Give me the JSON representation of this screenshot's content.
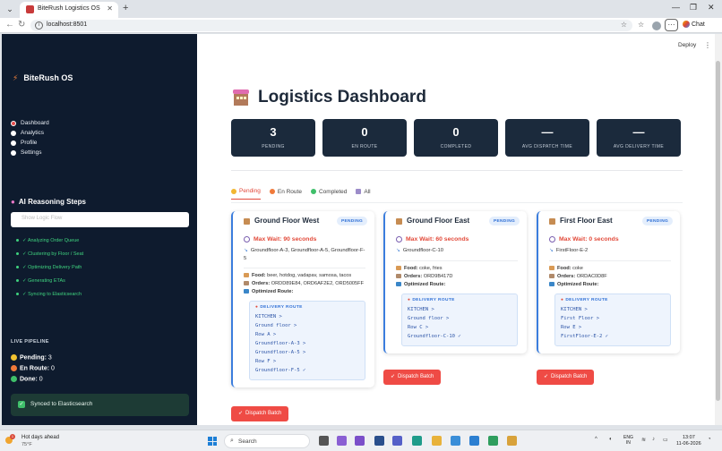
{
  "browser": {
    "tab_title": "BiteRush Logistics OS",
    "url": "localhost:8501",
    "chat_label": "Chat"
  },
  "toolbar": {
    "deploy": "Deploy"
  },
  "sidebar": {
    "brand": "BiteRush OS",
    "nav": [
      "Dashboard",
      "Analytics",
      "Profile",
      "Settings"
    ],
    "selected_nav": "Dashboard",
    "reasoning_title": "AI Reasoning Steps",
    "logic_placeholder": "Show Logic Flow",
    "steps": [
      "✓ Analyzing Order Queue",
      "✓ Clustering by Floor / Seat",
      "✓ Optimizing Delivery Path",
      "✓ Generating ETAs",
      "✓ Syncing to Elasticsearch"
    ],
    "pipeline_title": "LIVE PIPELINE",
    "pipeline": [
      {
        "label": "Pending:",
        "value": "3",
        "color": "#f2c231"
      },
      {
        "label": "En Route:",
        "value": "0",
        "color": "#f07a3a"
      },
      {
        "label": "Done:",
        "value": "0",
        "color": "#3fbf6a"
      }
    ],
    "synced": "Synced to Elasticsearch"
  },
  "main": {
    "title": "Logistics Dashboard",
    "kpis": [
      {
        "value": "3",
        "label": "PENDING"
      },
      {
        "value": "0",
        "label": "EN ROUTE"
      },
      {
        "value": "0",
        "label": "COMPLETED"
      },
      {
        "value": "—",
        "label": "AVG DISPATCH TIME"
      },
      {
        "value": "—",
        "label": "AVG DELIVERY TIME"
      }
    ],
    "tabs": [
      {
        "label": "Pending",
        "color": "#f2b631"
      },
      {
        "label": "En Route",
        "color": "#f07a3a"
      },
      {
        "label": "Completed",
        "color": "#3fbf6a"
      },
      {
        "label": "All",
        "color": "#9c8cc9"
      }
    ],
    "cards": [
      {
        "name": "Ground Floor West",
        "badge": "PENDING",
        "max_wait": "Max Wait: 90 seconds",
        "locations": "Groundfloor-A-3, Groundfloor-A-5, Groundfloor-F-5",
        "food_label": "Food:",
        "food": "beer, hotdog, vadapav, samosa, tacos",
        "orders_label": "Orders:",
        "orders": "ORDD89E84, ORD6AF2E2, ORD5005FF",
        "route_label": "Optimized Route:",
        "route_title": "DELIVERY ROUTE",
        "route": [
          "KITCHEN >",
          "Ground floor >",
          "Row A >",
          "Groundfloor-A-3 >",
          "Groundfloor-A-5 >",
          "Row F >",
          "Groundfloor-F-5 ✓"
        ],
        "dispatch": "Dispatch Batch"
      },
      {
        "name": "Ground Floor East",
        "badge": "PENDING",
        "max_wait": "Max Wait: 60 seconds",
        "locations": "Groundfloor-C-10",
        "food_label": "Food:",
        "food": "coke, fries",
        "orders_label": "Orders:",
        "orders": "ORD9B417D",
        "route_label": "Optimized Route:",
        "route_title": "DELIVERY ROUTE",
        "route": [
          "KITCHEN >",
          "Ground floor >",
          "Row C >",
          "Groundfloor-C-10 ✓"
        ],
        "dispatch": "Dispatch Batch"
      },
      {
        "name": "First Floor East",
        "badge": "PENDING",
        "max_wait": "Max Wait: 0 seconds",
        "locations": "FirstFloor-E-2",
        "food_label": "Food:",
        "food": "coke",
        "orders_label": "Orders:",
        "orders": "ORDAC0D8F",
        "route_label": "Optimized Route:",
        "route_title": "DELIVERY ROUTE",
        "route": [
          "KITCHEN >",
          "First Floor >",
          "Row E >",
          "FirstFloor-E-2 ✓"
        ],
        "dispatch": "Dispatch Batch"
      }
    ]
  },
  "taskbar": {
    "weather_title": "Hot days ahead",
    "weather_temp": "75°F",
    "weather_badge": "1",
    "search": "Search",
    "lang_1": "ENG",
    "lang_2": "IN",
    "time": "13:07",
    "date": "11-06-2026"
  }
}
